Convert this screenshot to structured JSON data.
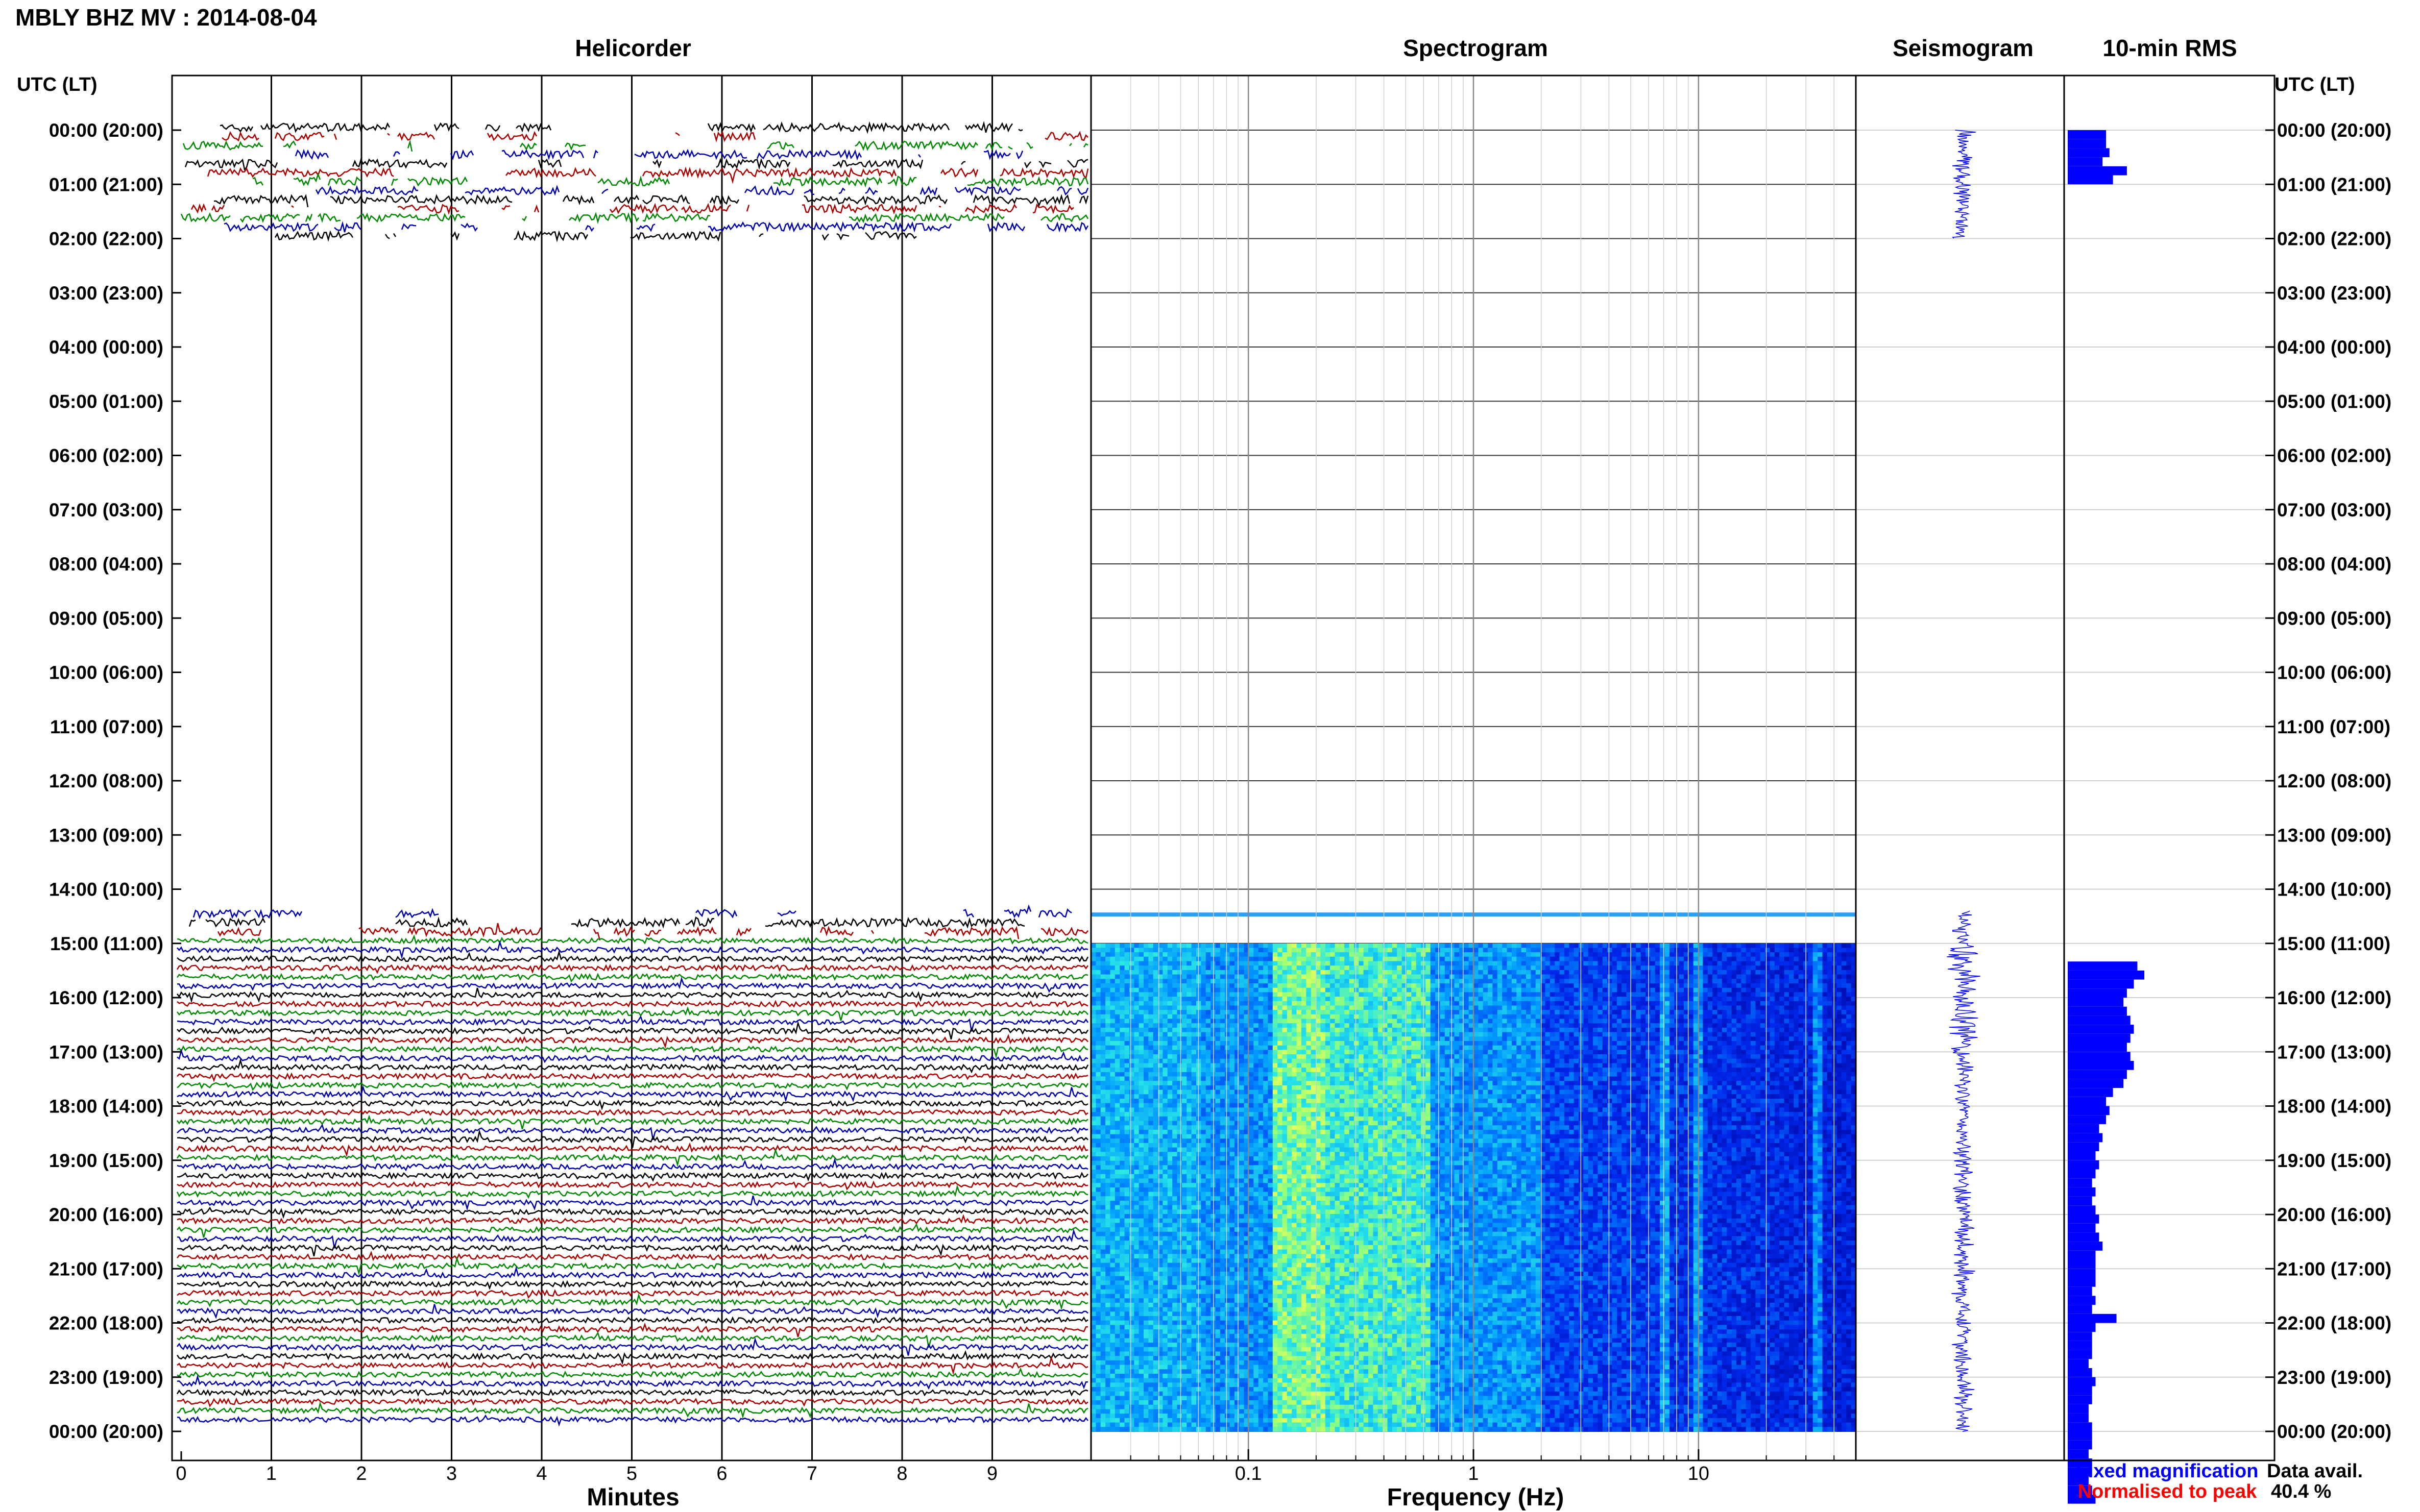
{
  "header": {
    "title": "MBLY BHZ MV : 2014-08-04",
    "utc_label_left": "UTC (LT)",
    "utc_label_right": "UTC (LT)"
  },
  "panels": {
    "helicorder": "Helicorder",
    "spectrogram": "Spectrogram",
    "seismogram": "Seismogram",
    "rms": "10-min RMS"
  },
  "axes": {
    "helicorder_xlabel": "Minutes",
    "spectrogram_xlabel": "Frequency (Hz)",
    "minute_ticks": [
      "0",
      "1",
      "2",
      "3",
      "4",
      "5",
      "6",
      "7",
      "8",
      "9"
    ],
    "freq_ticks": [
      "0.1",
      "1",
      "10"
    ]
  },
  "legend": {
    "fixed": "Fixed magnification",
    "normalised": "Normalised to peak",
    "data_avail_label": "Data avail.",
    "data_avail_value": "40.4 %"
  },
  "colors": {
    "trace_cycle": [
      "#000000",
      "#aa0000",
      "#008800",
      "#0000aa"
    ],
    "fixed_magnification": "#0000ff",
    "normalised_to_peak": "#ff0000",
    "rms_bar": "#0000ff",
    "seismogram": "#0000ff"
  },
  "chart_data": {
    "type": "helicorder",
    "hours": [
      "00:00 (20:00)",
      "01:00 (21:00)",
      "02:00 (22:00)",
      "03:00 (23:00)",
      "04:00 (00:00)",
      "05:00 (01:00)",
      "06:00 (02:00)",
      "07:00 (03:00)",
      "08:00 (04:00)",
      "09:00 (05:00)",
      "10:00 (06:00)",
      "11:00 (07:00)",
      "12:00 (08:00)",
      "13:00 (09:00)",
      "14:00 (10:00)",
      "15:00 (11:00)",
      "16:00 (12:00)",
      "17:00 (13:00)",
      "18:00 (14:00)",
      "19:00 (15:00)",
      "20:00 (16:00)",
      "21:00 (17:00)",
      "22:00 (18:00)",
      "23:00 (19:00)",
      "00:00 (20:00)"
    ],
    "minutes_range": [
      0,
      10
    ],
    "freq_range_hz": [
      0.02,
      50
    ],
    "data_present_hours": [
      [
        0,
        2
      ],
      [
        14.4,
        24
      ]
    ],
    "rms_10min": [
      0.55,
      0.55,
      0.6,
      0.5,
      0.85,
      0.65,
      0,
      0,
      0,
      0,
      0,
      0,
      0,
      0,
      0,
      0,
      0,
      0,
      0,
      0,
      0,
      0,
      0,
      0,
      0,
      0,
      0,
      0,
      0,
      0,
      0,
      0,
      0,
      0,
      0,
      0,
      0,
      0,
      0,
      0,
      0,
      0,
      0,
      0,
      0,
      0,
      0,
      0,
      0,
      0,
      0,
      0,
      0,
      0,
      0,
      0,
      0,
      0,
      0,
      0,
      0,
      0,
      0,
      0,
      0,
      0,
      0,
      0,
      0,
      0,
      0,
      0,
      0,
      0,
      0,
      0,
      0,
      0,
      0,
      0,
      0,
      0,
      0,
      0,
      0,
      0,
      0,
      0,
      0,
      0,
      0,
      0,
      1.0,
      1.1,
      0.95,
      0.85,
      0.8,
      0.85,
      0.9,
      0.95,
      0.9,
      0.85,
      0.9,
      0.95,
      0.85,
      0.8,
      0.65,
      0.55,
      0.6,
      0.55,
      0.45,
      0.5,
      0.45,
      0.4,
      0.45,
      0.4,
      0.35,
      0.4,
      0.35,
      0.4,
      0.45,
      0.4,
      0.45,
      0.5,
      0.4,
      0.4,
      0.4,
      0.4,
      0.35,
      0.4,
      0.35,
      0.7,
      0.4,
      0.35,
      0.35,
      0.35,
      0.3,
      0.35,
      0.4,
      0.35,
      0.35,
      0.3,
      0.3,
      0.35,
      0.35,
      0.35,
      0.3,
      0.35,
      0.35,
      0.3,
      0.35,
      0.4
    ]
  }
}
